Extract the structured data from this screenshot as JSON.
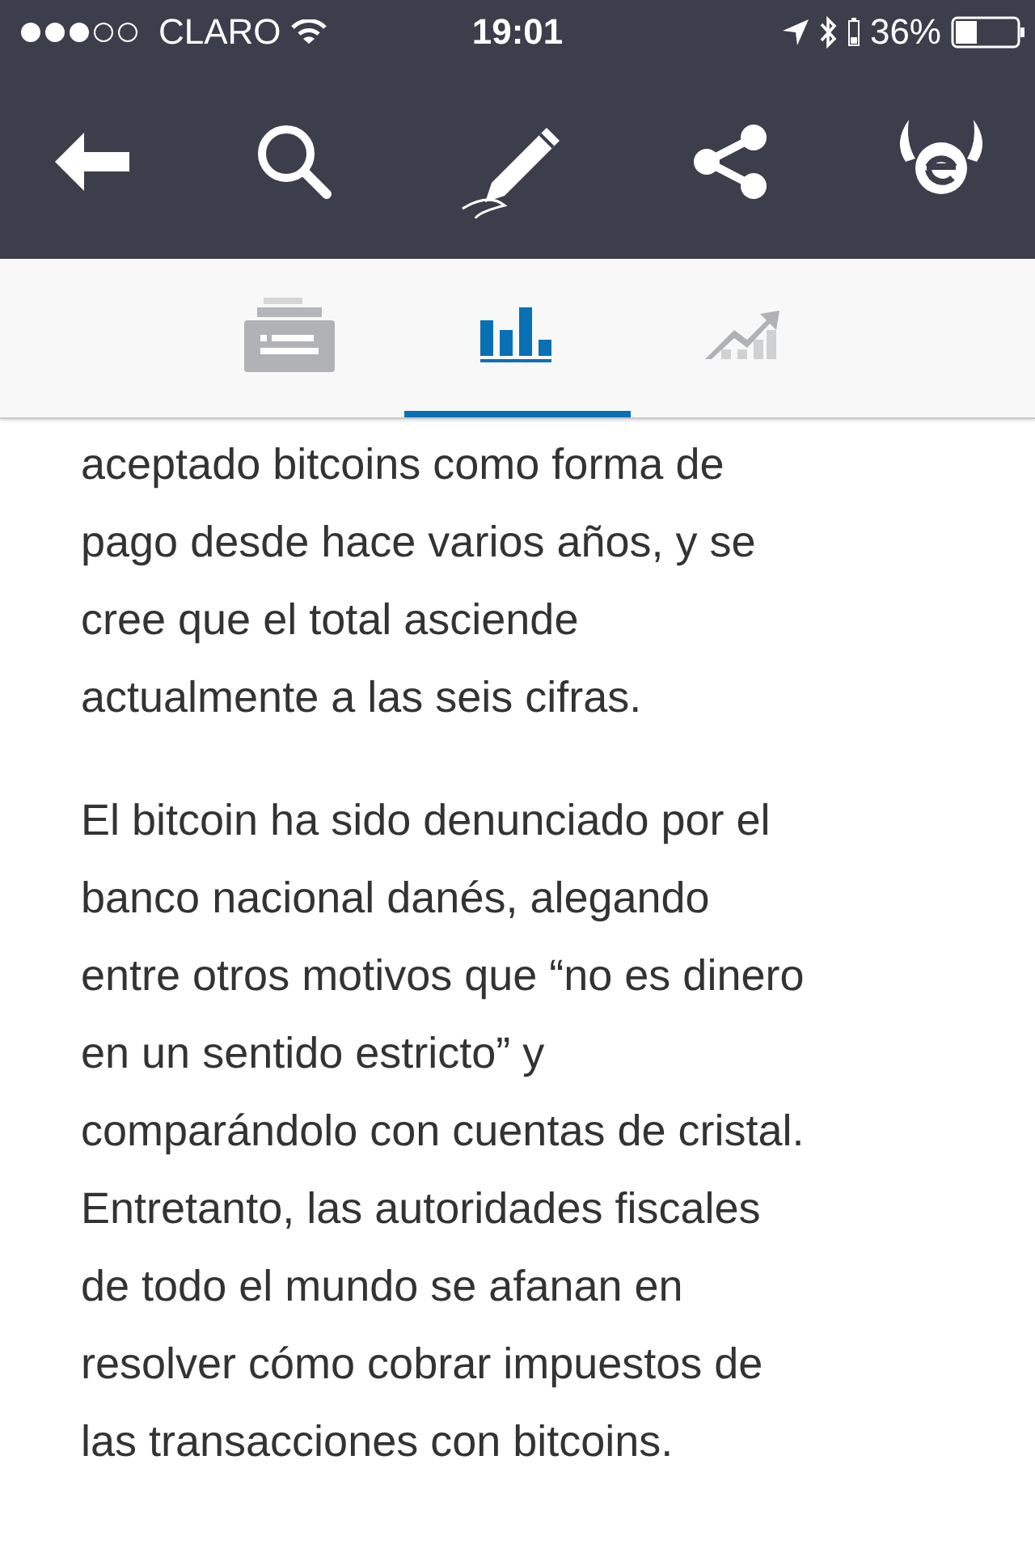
{
  "status_bar": {
    "carrier": "CLARO",
    "time": "19:01",
    "battery": "36%"
  },
  "toolbar": {
    "buttons": [
      {
        "kind": "back"
      },
      {
        "kind": "search"
      },
      {
        "kind": "edit"
      },
      {
        "kind": "share"
      },
      {
        "kind": "logo"
      }
    ]
  },
  "tabs": [
    {
      "kind": "news",
      "selected": false
    },
    {
      "kind": "chart",
      "selected": true
    },
    {
      "kind": "trend",
      "selected": false
    }
  ],
  "article": {
    "paragraphs": [
      {
        "lines": [
          "aceptado bitcoins como forma de",
          "pago desde hace varios años, y se",
          "cree que el total asciende",
          "actualmente a las seis cifras."
        ]
      },
      {
        "lines": [
          "El bitcoin ha sido denunciado por el",
          "banco nacional danés, alegando",
          "entre otros motivos que “no es dinero",
          "en un sentido estricto” y",
          "comparándolo con cuentas de cristal.",
          "Entretanto, las autoridades fiscales",
          "de todo el mundo se afanan en",
          "resolver cómo cobrar impuestos de",
          "las transacciones con bitcoins."
        ]
      }
    ]
  }
}
